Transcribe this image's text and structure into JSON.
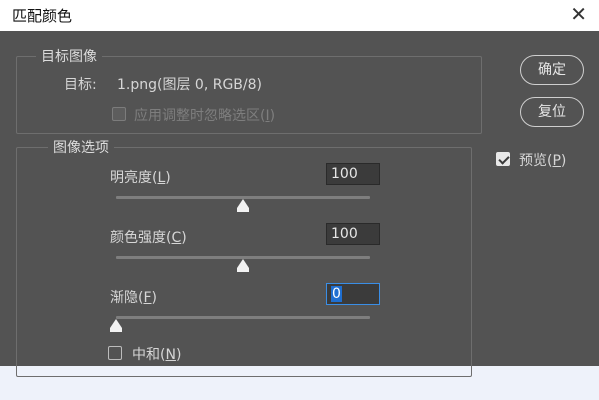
{
  "window": {
    "title": "匹配颜色",
    "close_glyph": "✕"
  },
  "target_group": {
    "legend": "目标图像",
    "target_label": "目标:",
    "target_value": "1.png(图层 0, RGB/8)",
    "ignore_selection": {
      "label_main": "应用调整时忽略选区(",
      "label_key": "I",
      "label_end": ")",
      "checked": false,
      "enabled": false
    }
  },
  "options_group": {
    "legend": "图像选项",
    "luminance": {
      "label_main": "明亮度(",
      "label_key": "L",
      "label_end": ")",
      "value": "100",
      "level_percent": 50
    },
    "color_intensity": {
      "label_main": "颜色强度(",
      "label_key": "C",
      "label_end": ")",
      "value": "100",
      "level_percent": 50
    },
    "fade": {
      "label_main": "渐隐(",
      "label_key": "F",
      "label_end": ")",
      "value": "0",
      "level_percent": 0
    },
    "neutralize": {
      "label_main": "中和(",
      "label_key": "N",
      "label_end": ")",
      "checked": false
    }
  },
  "buttons": {
    "ok": "确定",
    "reset": "复位"
  },
  "preview": {
    "label_main": "预览(",
    "label_key": "P",
    "label_end": ")",
    "checked": true
  },
  "colors": {
    "panel_bg": "#535353",
    "accent_focus": "#3a8ee6",
    "page_bg": "#eef2fa"
  }
}
